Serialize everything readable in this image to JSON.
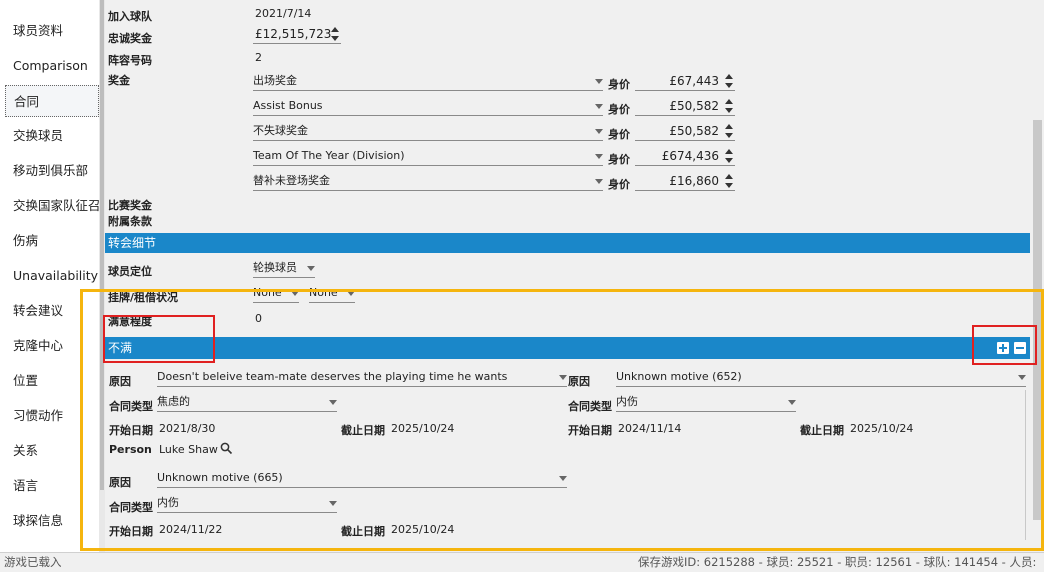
{
  "sidebar": {
    "items": [
      {
        "label": "球员资料"
      },
      {
        "label": "Comparison"
      },
      {
        "label": "合同"
      },
      {
        "label": "交换球员"
      },
      {
        "label": "移动到俱乐部"
      },
      {
        "label": "交换国家队征召"
      },
      {
        "label": "伤病"
      },
      {
        "label": "Unavailability"
      },
      {
        "label": "转会建议"
      },
      {
        "label": "克隆中心"
      },
      {
        "label": "位置"
      },
      {
        "label": "习惯动作"
      },
      {
        "label": "关系"
      },
      {
        "label": "语言"
      },
      {
        "label": "球探信息"
      }
    ]
  },
  "contract": {
    "join_label": "加入球队",
    "join_value": "2021/7/14",
    "loyalty_label": "忠诚奖金",
    "loyalty_value": "£12,515,723",
    "squad_label": "阵容号码",
    "squad_value": "2",
    "bonus_label": "奖金",
    "worth_label": "身价",
    "bonuses": [
      {
        "type": "出场奖金",
        "value": "£67,443"
      },
      {
        "type": "Assist Bonus",
        "value": "£50,582"
      },
      {
        "type": "不失球奖金",
        "value": "£50,582"
      },
      {
        "type": "Team Of The Year (Division)",
        "value": "£674,436"
      },
      {
        "type": "替补未登场奖金",
        "value": "£16,860"
      }
    ],
    "match_bonus_label": "比赛奖金",
    "clauses_label": "附属条款"
  },
  "transfer": {
    "header": "转会细节",
    "role_label": "球员定位",
    "role_value": "轮换球员",
    "status_label": "挂牌/租借状况",
    "status_value_1": "None",
    "status_value_2": "None",
    "happiness_label": "满意程度",
    "happiness_value": "0"
  },
  "unhappy": {
    "header": "不满",
    "reason_label": "原因",
    "contract_type_label": "合同类型",
    "start_label": "开始日期",
    "end_label": "截止日期",
    "person_label": "Person",
    "entries": [
      {
        "reason": "Doesn't beleive team-mate deserves the playing time he wants",
        "contract_type": "焦虑的",
        "start": "2021/8/30",
        "end": "2025/10/24",
        "person": "Luke Shaw"
      },
      {
        "reason": "Unknown motive (652)",
        "contract_type": "内伤",
        "start": "2024/11/14",
        "end": "2025/10/24"
      },
      {
        "reason": "Unknown motive (665)",
        "contract_type": "内伤",
        "start": "2024/11/22",
        "end": "2025/10/24"
      }
    ]
  },
  "status_bar": {
    "left": "游戏已载入",
    "right": "保存游戏ID: 6215288 - 球员: 25521 - 职员: 12561 - 球队: 141454 - 人员:"
  },
  "colors": {
    "accent": "#1a87c9",
    "highlight_red": "#e02020",
    "highlight_yellow": "#f5b50e"
  }
}
